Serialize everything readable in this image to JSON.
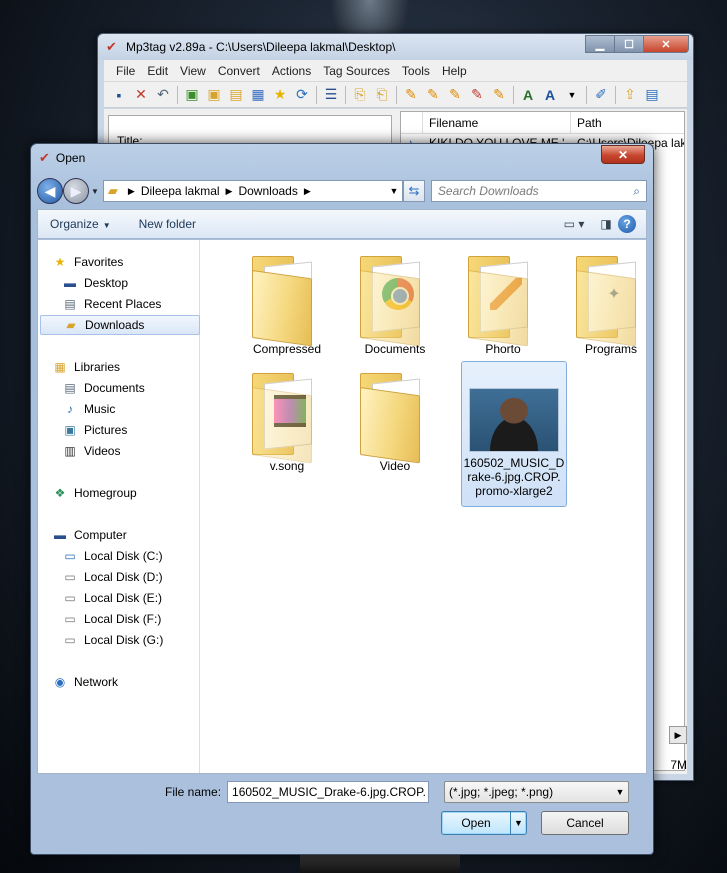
{
  "mp3tag": {
    "title": "Mp3tag v2.89a  -  C:\\Users\\Dileepa lakmal\\Desktop\\",
    "menu": [
      "File",
      "Edit",
      "View",
      "Convert",
      "Actions",
      "Tag Sources",
      "Tools",
      "Help"
    ],
    "left_label": "Title:",
    "columns": [
      "Filename",
      "Path"
    ],
    "row": {
      "filename": "KIKI DO YOU LOVE ME.'",
      "path": "C:\\Users\\Dileepa lak"
    },
    "status": "7M"
  },
  "dialog": {
    "title": "Open",
    "address": {
      "segments": [
        "Dileepa lakmal",
        "Downloads"
      ]
    },
    "search_placeholder": "Search Downloads",
    "commands": {
      "organize": "Organize",
      "new_folder": "New folder"
    },
    "nav": {
      "favorites": "Favorites",
      "desktop": "Desktop",
      "recent": "Recent Places",
      "downloads": "Downloads",
      "libraries": "Libraries",
      "documents": "Documents",
      "music": "Music",
      "pictures": "Pictures",
      "videos": "Videos",
      "homegroup": "Homegroup",
      "computer": "Computer",
      "disk_c": "Local Disk (C:)",
      "disk_d": "Local Disk (D:)",
      "disk_e": "Local Disk (E:)",
      "disk_f": "Local Disk (F:)",
      "disk_g": "Local Disk (G:)",
      "network": "Network"
    },
    "items": {
      "compressed": "Compressed",
      "documents": "Documents",
      "phorto": "Phorto",
      "programs": "Programs",
      "vsong": "v.song",
      "video": "Video",
      "image_line1": "160502_MUSIC_D",
      "image_line2": "rake-6.jpg.CROP.",
      "image_line3": "promo-xlarge2"
    },
    "file_name_label": "File name:",
    "file_name_value": "160502_MUSIC_Drake-6.jpg.CROP.",
    "file_type": "(*.jpg; *.jpeg; *.png)",
    "open_label": "Open",
    "cancel_label": "Cancel"
  }
}
